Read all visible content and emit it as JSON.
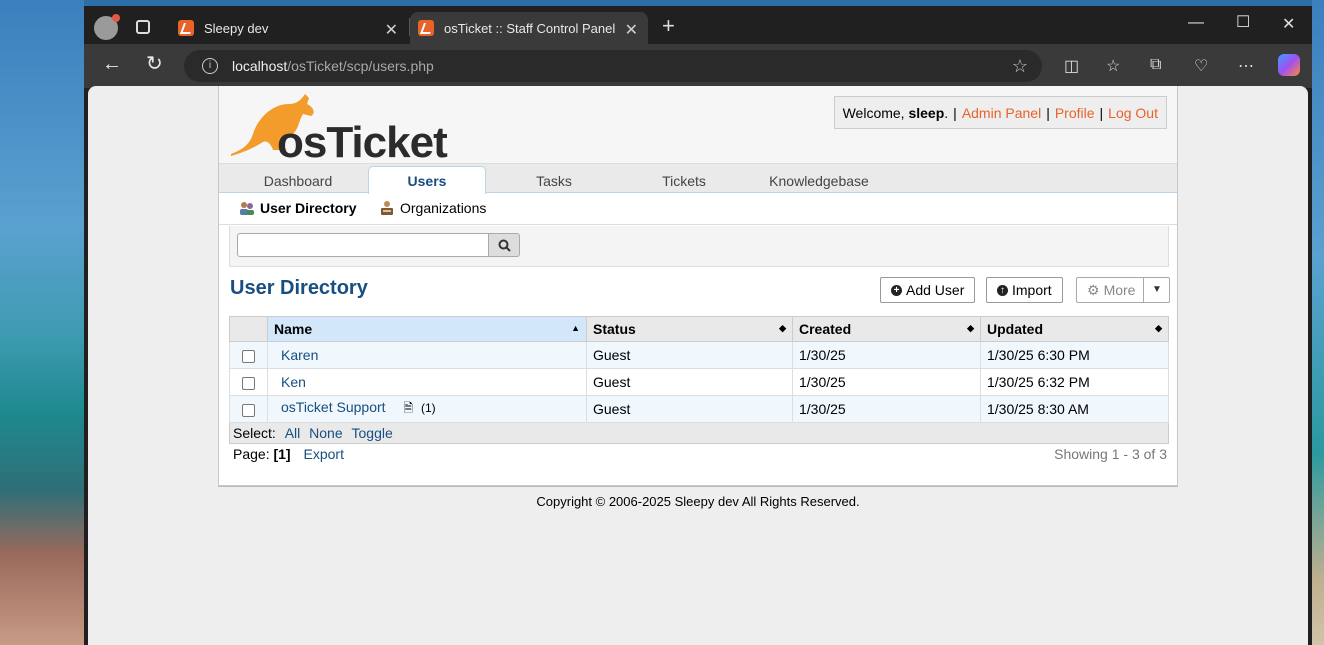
{
  "browser": {
    "tabs": [
      {
        "title": "Sleepy dev"
      },
      {
        "title": "osTicket :: Staff Control Panel"
      }
    ],
    "url_host": "localhost",
    "url_path": "/osTicket/scp/users.php"
  },
  "header": {
    "logo_text": "osTicket",
    "welcome_prefix": "Welcome,",
    "username": "sleep",
    "welcome_suffix": ".",
    "links": {
      "admin": "Admin Panel",
      "profile": "Profile",
      "logout": "Log Out"
    },
    "sep": "|"
  },
  "nav": {
    "tabs": [
      {
        "label": "Dashboard"
      },
      {
        "label": "Users"
      },
      {
        "label": "Tasks"
      },
      {
        "label": "Tickets"
      },
      {
        "label": "Knowledgebase"
      }
    ],
    "active_tab": "Users"
  },
  "subnav": {
    "items": [
      {
        "label": "User Directory"
      },
      {
        "label": "Organizations"
      }
    ]
  },
  "search": {
    "placeholder": "",
    "button_icon": "search-icon"
  },
  "main": {
    "title": "User Directory",
    "buttons": {
      "add_user": "Add User",
      "import": "Import",
      "more": "More"
    }
  },
  "table": {
    "columns": [
      "Name",
      "Status",
      "Created",
      "Updated"
    ],
    "rows": [
      {
        "name": "Karen",
        "status": "Guest",
        "created": "1/30/25",
        "updated": "1/30/25 6:30 PM",
        "note": ""
      },
      {
        "name": "Ken",
        "status": "Guest",
        "created": "1/30/25",
        "updated": "1/30/25 6:32 PM",
        "note": ""
      },
      {
        "name": "osTicket Support",
        "status": "Guest",
        "created": "1/30/25",
        "updated": "1/30/25 8:30 AM",
        "note": "(1)"
      }
    ],
    "select_label": "Select:",
    "select_all": "All",
    "select_none": "None",
    "select_toggle": "Toggle"
  },
  "pager": {
    "label": "Page:",
    "current": "[1]",
    "export": "Export",
    "showing": "Showing 1 - 3 of 3"
  },
  "footer": {
    "copyright": "Copyright © 2006-2025 Sleepy dev All Rights Reserved."
  },
  "colors": {
    "brand_orange": "#e8622a",
    "link_blue": "#184e81",
    "active_header": "#d3e7fa"
  }
}
